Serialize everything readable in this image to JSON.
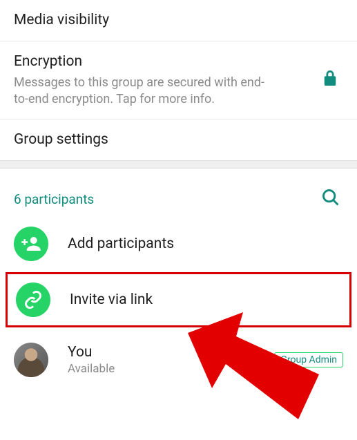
{
  "settings": {
    "media_visibility": {
      "title": "Media visibility"
    },
    "encryption": {
      "title": "Encryption",
      "subtitle": "Messages to this group are secured with end-to-end encryption. Tap for more info."
    },
    "group_settings": {
      "title": "Group settings"
    }
  },
  "participants": {
    "count_label": "6 participants",
    "add_label": "Add participants",
    "invite_link_label": "Invite via link",
    "you": {
      "name": "You",
      "status": "Available",
      "badge": "Group Admin"
    }
  },
  "colors": {
    "accent": "#128c7e",
    "action": "#25d366",
    "annotation": "#d60000"
  }
}
